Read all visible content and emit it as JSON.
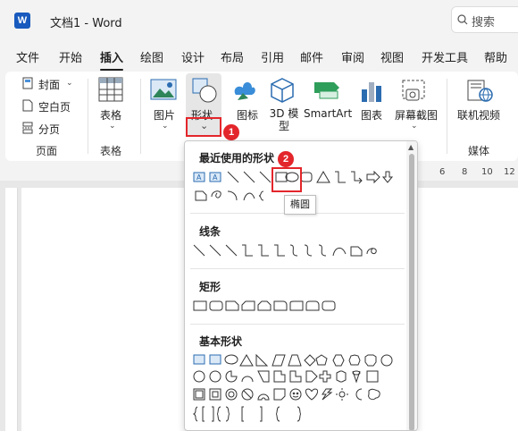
{
  "titlebar": {
    "doc_title": "文档1 - Word",
    "logo_letter": "W",
    "search_label": "搜索"
  },
  "tabs": [
    "文件",
    "开始",
    "插入",
    "绘图",
    "设计",
    "布局",
    "引用",
    "邮件",
    "审阅",
    "视图",
    "开发工具",
    "帮助"
  ],
  "active_tab": "插入",
  "ribbon": {
    "pages": {
      "cover": "封面",
      "blank": "空白页",
      "break": "分页",
      "group": "页面"
    },
    "table": {
      "label": "表格",
      "group": "表格"
    },
    "illustrations": {
      "picture": "图片",
      "shapes": "形状",
      "icons": "图标",
      "model3d": "3D 模型",
      "smartart": "SmartArt",
      "chart": "图表",
      "screenshot": "屏幕截图"
    },
    "media": {
      "online_video": "联机视频",
      "group": "媒体"
    }
  },
  "ruler": [
    "6",
    "8",
    "10",
    "12"
  ],
  "shapes_menu": {
    "recent": "最近使用的形状",
    "lines": "线条",
    "rectangles": "矩形",
    "basic": "基本形状"
  },
  "tooltip": "椭圆",
  "badges": [
    "1",
    "2"
  ],
  "colors": {
    "accent": "#e3262b",
    "word_blue": "#185abd"
  }
}
